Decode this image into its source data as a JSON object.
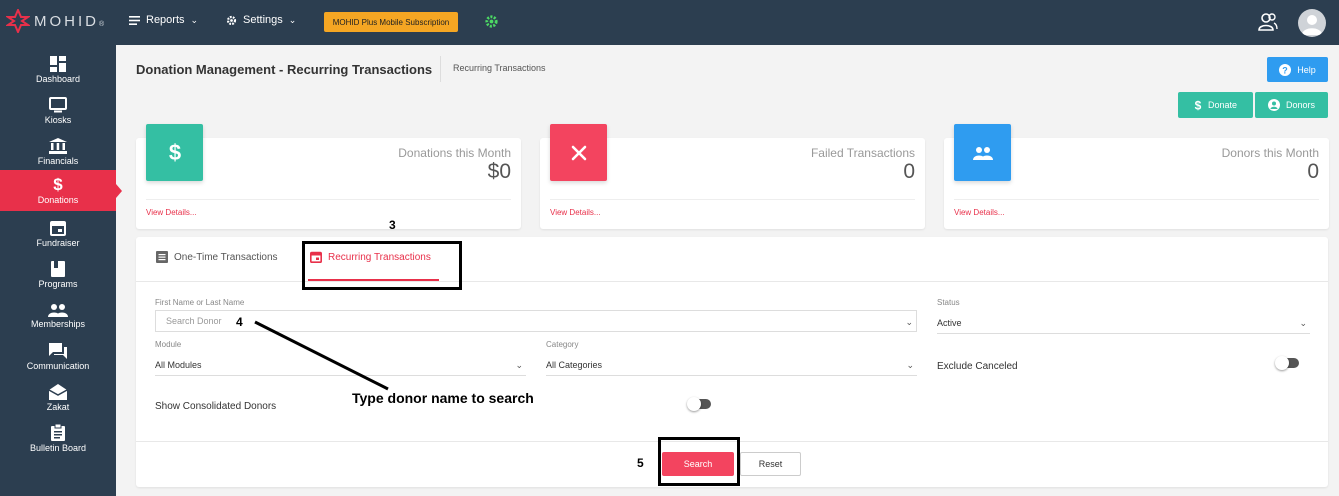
{
  "topbar": {
    "logo_text": "MOHID",
    "logo_mark": "®",
    "reports_label": "Reports",
    "settings_label": "Settings",
    "subscription_label": "MOHID Plus Mobile Subscription"
  },
  "sidebar": {
    "items": [
      {
        "label": "Dashboard",
        "icon": "dashboard-icon"
      },
      {
        "label": "Kiosks",
        "icon": "kiosk-icon"
      },
      {
        "label": "Financials",
        "icon": "bank-icon"
      },
      {
        "label": "Donations",
        "icon": "dollar-icon"
      },
      {
        "label": "Fundraiser",
        "icon": "calendar-icon"
      },
      {
        "label": "Programs",
        "icon": "book-icon"
      },
      {
        "label": "Memberships",
        "icon": "people-icon"
      },
      {
        "label": "Communication",
        "icon": "chat-icon"
      },
      {
        "label": "Zakat",
        "icon": "envelope-icon"
      },
      {
        "label": "Bulletin Board",
        "icon": "clipboard-icon"
      }
    ],
    "active": "Donations"
  },
  "header": {
    "title": "Donation Management - Recurring Transactions",
    "breadcrumb": "Recurring Transactions",
    "help_label": "Help",
    "donate_label": "Donate",
    "donors_label": "Donors"
  },
  "cards": [
    {
      "label": "Donations this Month",
      "value": "$0",
      "link": "View Details...",
      "color": "#34bfa3",
      "icon": "dollar-icon"
    },
    {
      "label": "Failed Transactions",
      "value": "0",
      "link": "View Details...",
      "color": "#f3445f",
      "icon": "close-icon"
    },
    {
      "label": "Donors this Month",
      "value": "0",
      "link": "View Details...",
      "color": "#2f9cf0",
      "icon": "people-icon"
    }
  ],
  "tabs": {
    "one_time": "One-Time Transactions",
    "recurring": "Recurring Transactions"
  },
  "filters": {
    "name_label": "First Name or Last Name",
    "name_placeholder": "Search Donor",
    "status_label": "Status",
    "status_value": "Active",
    "module_label": "Module",
    "module_value": "All Modules",
    "category_label": "Category",
    "category_value": "All Categories",
    "exclude_canceled_label": "Exclude Canceled",
    "show_consolidated_label": "Show Consolidated Donors"
  },
  "actions": {
    "search_label": "Search",
    "reset_label": "Reset"
  },
  "annotations": {
    "step3": "3",
    "step4": "4",
    "step5": "5",
    "hint": "Type donor name to search"
  },
  "colors": {
    "sidebar_bg": "#2c3e50",
    "accent": "#e8304a",
    "green": "#34bfa3",
    "blue": "#2f9cf0",
    "subscription": "#f5a623"
  }
}
